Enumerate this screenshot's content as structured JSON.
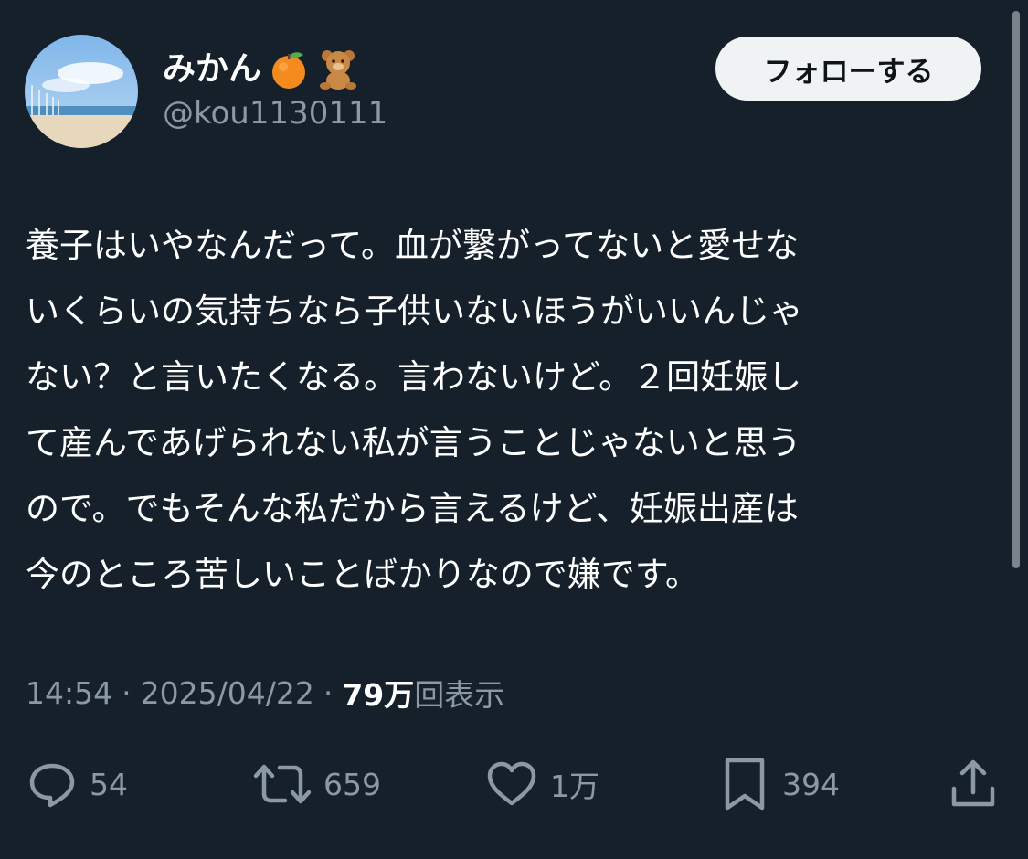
{
  "author": {
    "display_name": "みかん",
    "name_emojis": [
      "tangerine-emoji",
      "teddy-bear-emoji"
    ],
    "handle": "@kou1130111",
    "avatar_description_icon": "beach-with-wind-turbines-avatar"
  },
  "follow_button": {
    "label": "フォローする"
  },
  "tweet": {
    "lines": [
      "養子はいやなんだって。血が繋がってないと愛せな",
      "いくらいの気持ちなら子供いないほうがいいんじゃ",
      "ない？と言いたくなる。言わないけど。２回妊娠し",
      "て産んであげられない私が言うことじゃないと思う",
      "ので。でもそんな私だから言えるけど、妊娠出産は",
      "今のところ苦しいことばかりなので嫌です。"
    ]
  },
  "meta": {
    "time": "14:54",
    "separator": "·",
    "date": "2025/04/22",
    "views_count": "79万",
    "views_label": "回表示"
  },
  "actions": {
    "reply": {
      "icon": "reply-bubble-icon",
      "count": "54"
    },
    "retweet": {
      "icon": "retweet-icon",
      "count": "659"
    },
    "like": {
      "icon": "heart-icon",
      "count": "1万"
    },
    "bookmark": {
      "icon": "bookmark-icon",
      "count": "394"
    },
    "share": {
      "icon": "share-upload-icon"
    }
  },
  "colors": {
    "background": "#15202b",
    "secondary_text": "#8b98a5",
    "primary_text": "#ffffff",
    "follow_button_bg": "#eff3f4",
    "follow_button_text": "#0f1419"
  }
}
